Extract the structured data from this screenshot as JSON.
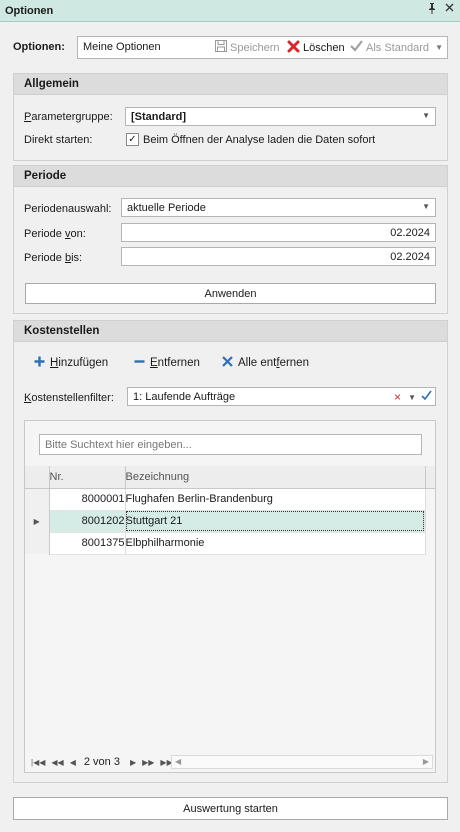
{
  "panel": {
    "title": "Optionen",
    "pin_icon": "pin-icon",
    "close_icon": "close-icon"
  },
  "options": {
    "label": "Optionen:",
    "value": "Meine Optionen",
    "save_label": "Speichern",
    "delete_label": "Löschen",
    "default_label": "Als Standard"
  },
  "allgemein": {
    "header": "Allgemein",
    "param_label_u": "P",
    "param_label_rest": "arametergruppe:",
    "param_value": "[Standard]",
    "direkt_label": "Direkt starten:",
    "direkt_checked": "✓",
    "direkt_text": "Beim Öffnen der Analyse laden die Daten sofort"
  },
  "periode": {
    "header": "Periode",
    "auswahl_label": "Periodenauswahl:",
    "auswahl_value": "aktuelle Periode",
    "von_label_pre": "Periode ",
    "von_label_u": "v",
    "von_label_post": "on:",
    "von_value": "02.2024",
    "bis_label_pre": "Periode ",
    "bis_label_u": "b",
    "bis_label_post": "is:",
    "bis_value": "02.2024",
    "apply_label": "Anwenden"
  },
  "kostenstellen": {
    "header": "Kostenstellen",
    "add_u": "H",
    "add_rest": "inzufügen",
    "remove_u": "E",
    "remove_rest": "ntfernen",
    "remove_all_pre": "Alle ent",
    "remove_all_u": "f",
    "remove_all_post": "ernen",
    "filter_label_u": "K",
    "filter_label_rest": "ostenstellenfilter:",
    "filter_value": "1: Laufende Aufträge",
    "search_placeholder": "Bitte Suchtext hier eingeben...",
    "columns": [
      "Nr.",
      "Bezeichnung"
    ],
    "rows": [
      {
        "nr": "8000001",
        "name": "Flughafen Berlin-Brandenburg"
      },
      {
        "nr": "8001202",
        "name": "Stuttgart 21"
      },
      {
        "nr": "8001375",
        "name": "Elbphilharmonie"
      }
    ],
    "pager_info": "2 von 3"
  },
  "footer": {
    "start_label": "Auswertung starten"
  },
  "colors": {
    "title_bg": "#cfe9e2",
    "selected_row": "#d5ece6",
    "delete_red": "#d9262b",
    "add_blue": "#2f6fb5"
  }
}
